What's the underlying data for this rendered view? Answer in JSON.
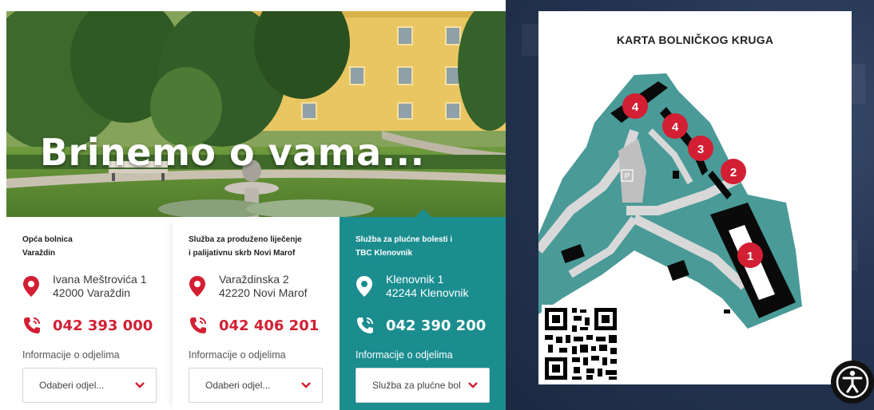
{
  "hero": {
    "title": "Brinemo o vama..."
  },
  "cards": [
    {
      "title_line1": "Opća bolnica",
      "title_line2": "Varaždin",
      "address_line1": "Ivana Meštrovića 1",
      "address_line2": "42000 Varaždin",
      "phone": "042 393 000",
      "info_label": "Informacije o odjelima",
      "select_value": "Odaberi odjel..."
    },
    {
      "title_line1": "Služba za produženo liječenje",
      "title_line2": "i palijativnu skrb Novi Marof",
      "address_line1": "Varaždinska 2",
      "address_line2": "42220 Novi Marof",
      "phone": "042 406 201",
      "info_label": "Informacije o odjelima",
      "select_value": "Odaberi odjel..."
    },
    {
      "title_line1": "Služba za plućne bolesti i",
      "title_line2": "TBC Klenovnik",
      "address_line1": "Klenovnik 1",
      "address_line2": "42244 Klenovnik",
      "phone": "042 390 200",
      "info_label": "Informacije o odjelima",
      "select_value": "Služba za plućne bolesti"
    }
  ],
  "map": {
    "title": "KARTA BOLNIČKOG KRUGA",
    "parking_label": "P",
    "markers": [
      "4",
      "4",
      "3",
      "2",
      "1"
    ]
  },
  "colors": {
    "accent_red": "#d31f33",
    "teal": "#1b8d8f",
    "map_green": "#4a9a98",
    "dark_blue": "#263654"
  },
  "icons": {
    "location": "location-pin-icon",
    "phone": "phone-icon",
    "chevron": "chevron-down-icon",
    "accessibility": "accessibility-icon"
  }
}
